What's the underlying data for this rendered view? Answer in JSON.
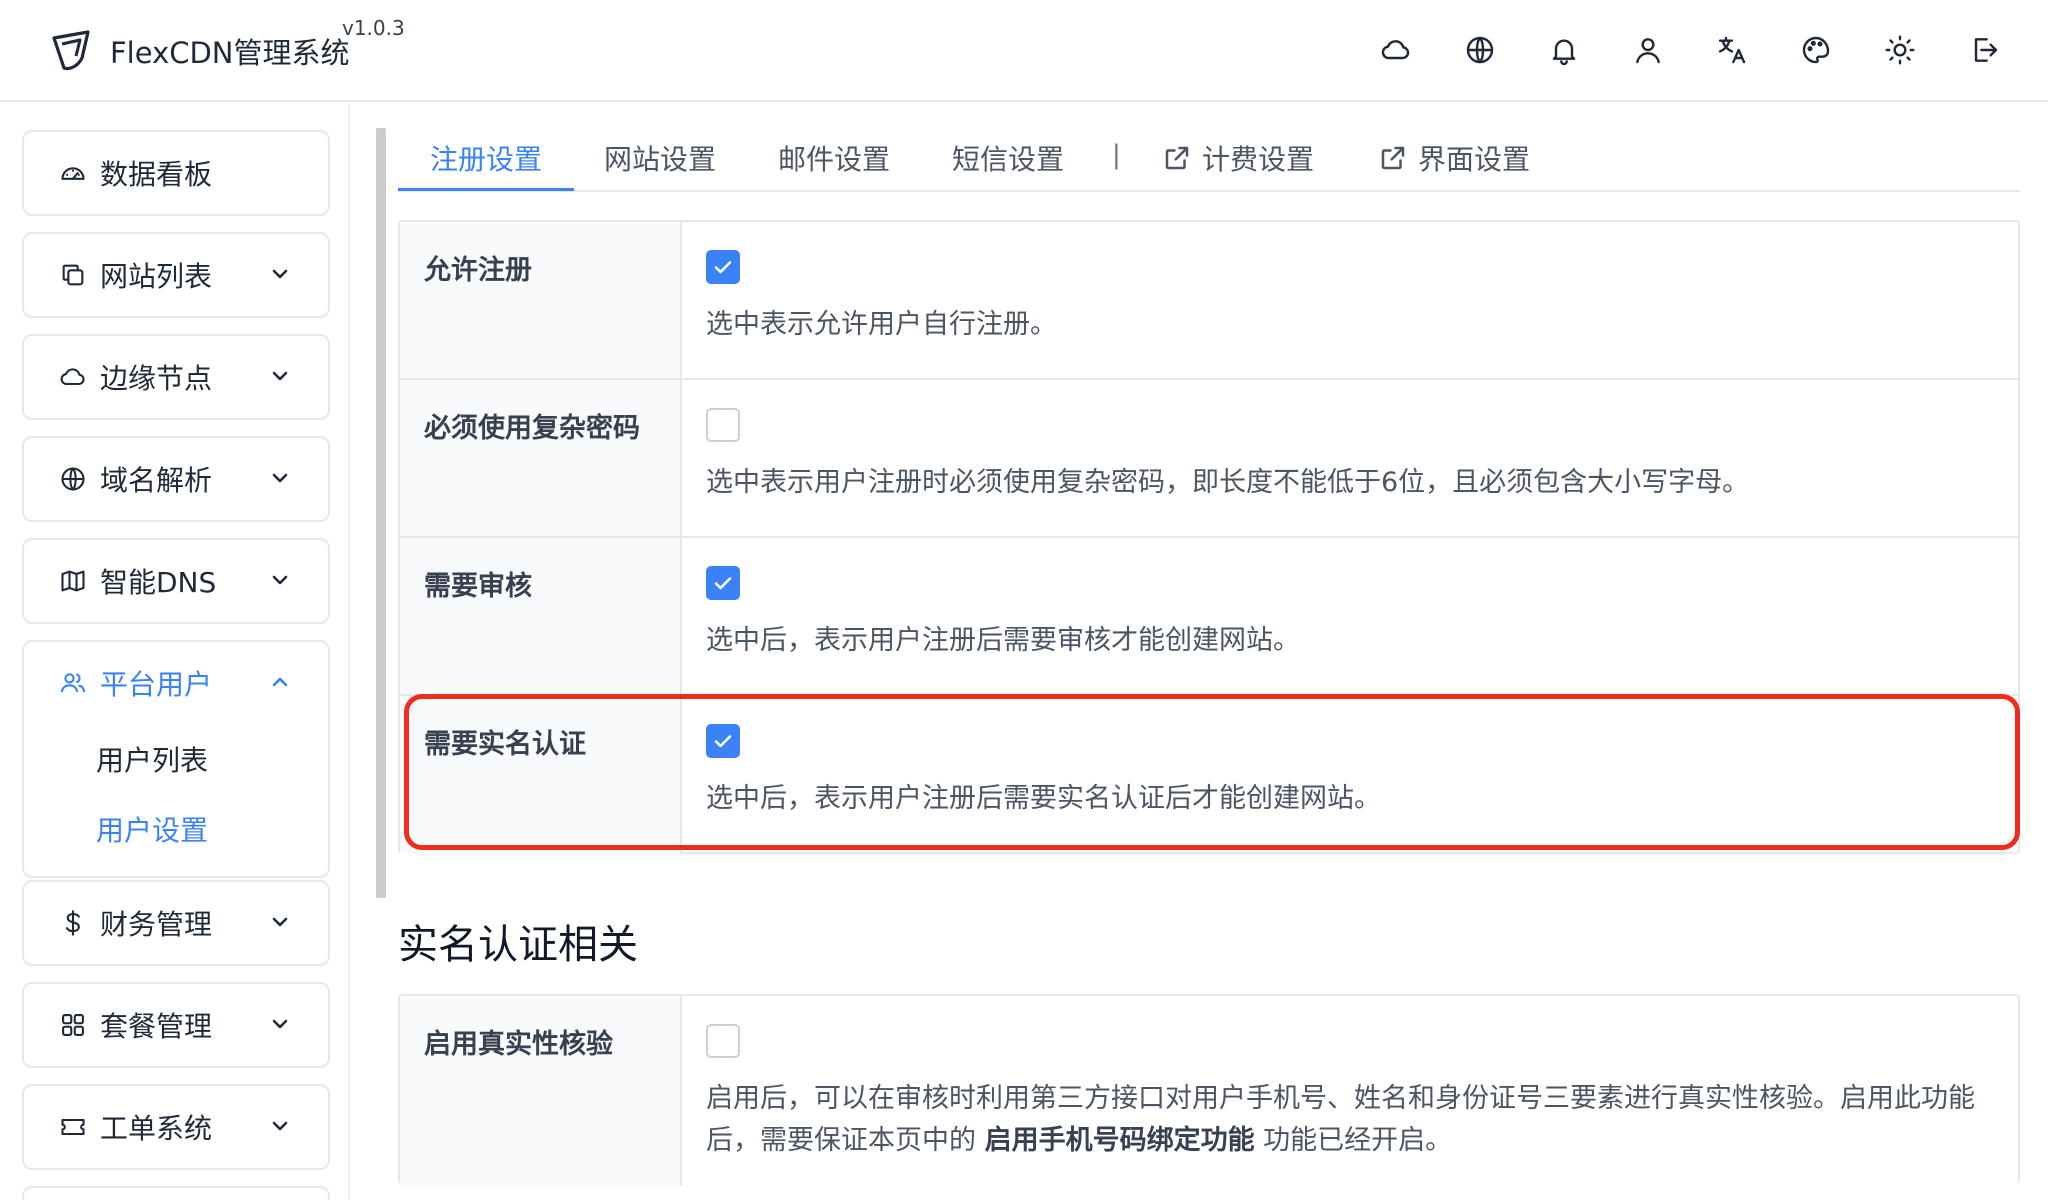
{
  "header": {
    "app_title": "FlexCDN管理系统",
    "version": "v1.0.3",
    "icons": [
      "cloud-icon",
      "globe-icon",
      "bell-icon",
      "user-icon",
      "translate-icon",
      "palette-icon",
      "sun-icon",
      "logout-icon"
    ]
  },
  "sidebar": {
    "items": [
      {
        "label": "数据看板",
        "icon": "dashboard-icon"
      },
      {
        "label": "网站列表",
        "icon": "copy-icon"
      },
      {
        "label": "边缘节点",
        "icon": "cloud-icon"
      },
      {
        "label": "域名解析",
        "icon": "globe-icon"
      },
      {
        "label": "智能DNS",
        "icon": "map-icon"
      },
      {
        "label": "平台用户",
        "icon": "users-icon",
        "expanded": true,
        "sub_items": [
          {
            "label": "用户列表"
          },
          {
            "label": "用户设置",
            "active": true
          }
        ]
      },
      {
        "label": "财务管理",
        "icon": "dollar-icon"
      },
      {
        "label": "套餐管理",
        "icon": "grid-icon"
      },
      {
        "label": "工单系统",
        "icon": "ticket-icon"
      }
    ]
  },
  "tabs": [
    {
      "label": "注册设置",
      "active": true
    },
    {
      "label": "网站设置"
    },
    {
      "label": "邮件设置"
    },
    {
      "label": "短信设置"
    },
    {
      "label": "计费设置",
      "icon": "external-link-icon"
    },
    {
      "label": "界面设置",
      "icon": "external-link-icon"
    }
  ],
  "tab_separator": "|",
  "registration_settings": [
    {
      "label": "允许注册",
      "checked": true,
      "description": "选中表示允许用户自行注册。"
    },
    {
      "label": "必须使用复杂密码",
      "checked": false,
      "description": "选中表示用户注册时必须使用复杂密码，即长度不能低于6位，且必须包含大小写字母。"
    },
    {
      "label": "需要审核",
      "checked": true,
      "description": "选中后，表示用户注册后需要审核才能创建网站。"
    },
    {
      "label": "需要实名认证",
      "checked": true,
      "description": "选中后，表示用户注册后需要实名认证后才能创建网站。",
      "highlighted": true
    }
  ],
  "real_name_section": {
    "title": "实名认证相关",
    "rows": [
      {
        "label": "启用真实性核验",
        "checked": false,
        "description_before": "启用后，可以在审核时利用第三方接口对用户手机号、姓名和身份证号三要素进行真实性核验。启用此功能后，需要保证本页中的 ",
        "description_bold": "启用手机号码绑定功能",
        "description_after": " 功能已经开启。"
      }
    ]
  },
  "colors": {
    "accent": "#3b82f6",
    "highlight": "#ef2d1f"
  }
}
